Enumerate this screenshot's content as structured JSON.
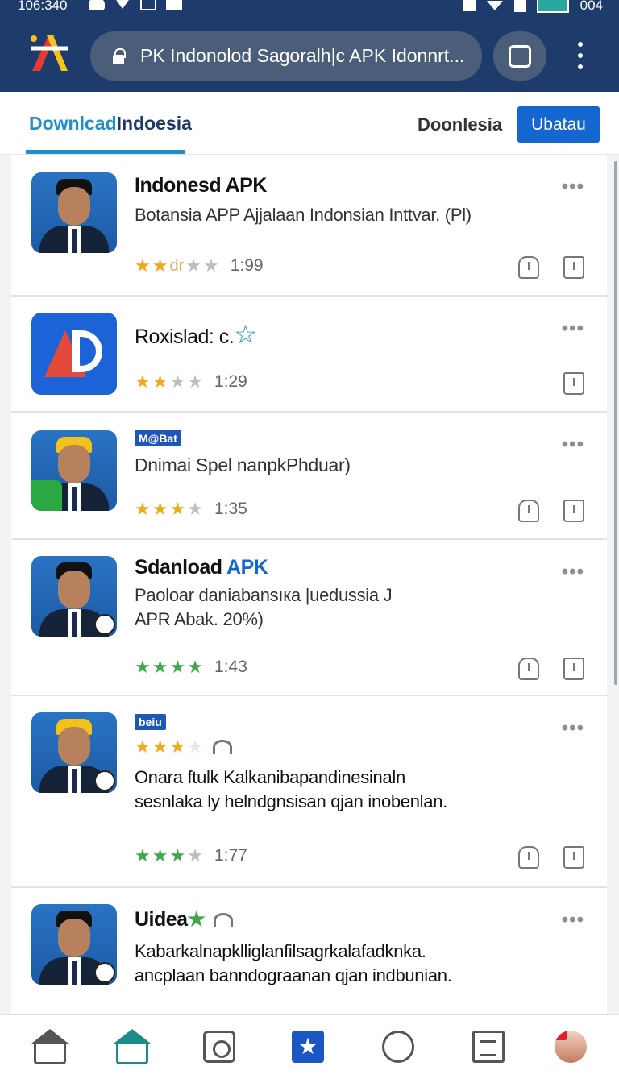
{
  "status_bar": {
    "time": "106:340",
    "battery_text": "004"
  },
  "browser": {
    "url": "PK Indonolod Sagoralh|c APK Idonnrt...",
    "logo_icon": "apk-logo-icon",
    "tabs_icon": "tabs-icon",
    "menu_icon": "more-vert-icon"
  },
  "header": {
    "tab_active_part1": "Downlcad",
    "tab_active_part2": "Indoesia",
    "tab_other": "Doonlesia",
    "primary_button": "Ubatau"
  },
  "apps": [
    {
      "title": "Indonesd APK",
      "description_lines": [
        "Botansia APP Ajjalaan Indonsian Inttvar. (Pl)"
      ],
      "rating_text": "dr",
      "stars": 2,
      "count": "1:99"
    },
    {
      "title": "Roxislad: c.",
      "stars": 2,
      "count": "1:29"
    },
    {
      "tag": "M@Bat",
      "description_lines": [
        "Dnimai Spel nanpkPhduar)"
      ],
      "stars": 3,
      "count": "1:35"
    },
    {
      "title_part1": "Sdanload",
      "title_part2": "APK",
      "description_lines": [
        "Paoloar daniabansıка |uedussia J",
        "APR Abak. 20%)"
      ],
      "stars": 4,
      "count": "1:43"
    },
    {
      "tag": "beiu",
      "top_stars": 3,
      "description_lines": [
        "Onara ftulk Kalkanibapandinesinaln",
        "sesnlaka ly helndgnsisan qjan inobenlan."
      ],
      "stars": 3,
      "count": "1:77"
    },
    {
      "title": "Uidea",
      "description_lines": [
        "Kabarkalnapklliglanfilsagrkalafadknka.",
        "ancplaan banndograanan qjan indbunian."
      ]
    }
  ],
  "bottom_nav": [
    {
      "icon": "home-outline-icon"
    },
    {
      "icon": "home-active-icon"
    },
    {
      "icon": "settings-icon"
    },
    {
      "icon": "star-badge-icon"
    },
    {
      "icon": "chat-icon"
    },
    {
      "icon": "list-icon"
    },
    {
      "icon": "profile-avatar-icon"
    }
  ],
  "colors": {
    "chrome": "#1d3c6b",
    "accent_blue": "#1466d0",
    "tab_teal": "#1e8fc7",
    "star_gold": "#f2a81a",
    "star_green": "#3ea94a"
  }
}
